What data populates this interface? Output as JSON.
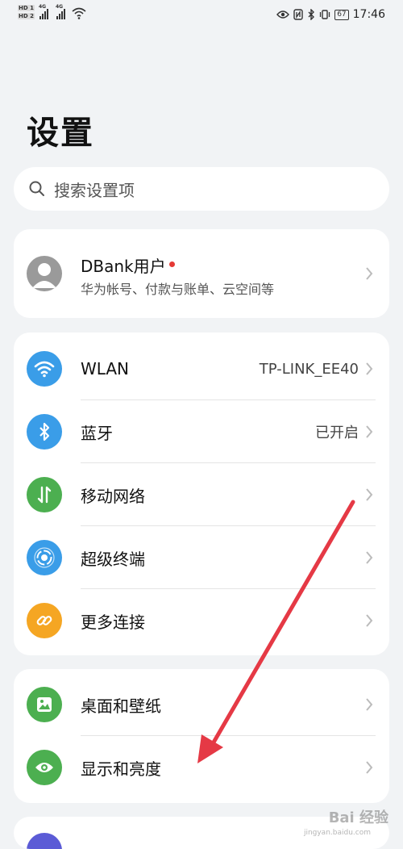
{
  "status_bar": {
    "hd1": "HD 1",
    "hd2": "HD 2",
    "net1": "4G",
    "net2": "4G",
    "battery": "67",
    "time": "17:46"
  },
  "page_title": "设置",
  "search": {
    "placeholder": "搜索设置项"
  },
  "account": {
    "name": "DBank用户",
    "subtitle": "华为帐号、付款与账单、云空间等"
  },
  "connectivity": [
    {
      "label": "WLAN",
      "value": "TP-LINK_EE40",
      "icon": "wifi-icon",
      "color": "#3a9de8"
    },
    {
      "label": "蓝牙",
      "value": "已开启",
      "icon": "bluetooth-icon",
      "color": "#3a9de8"
    },
    {
      "label": "移动网络",
      "value": "",
      "icon": "mobile-data-icon",
      "color": "#4caf50"
    },
    {
      "label": "超级终端",
      "value": "",
      "icon": "super-device-icon",
      "color": "#3a9de8"
    },
    {
      "label": "更多连接",
      "value": "",
      "icon": "link-icon",
      "color": "#f5a623"
    }
  ],
  "display_group": [
    {
      "label": "桌面和壁纸",
      "icon": "wallpaper-icon",
      "color": "#4caf50"
    },
    {
      "label": "显示和亮度",
      "icon": "eye-icon",
      "color": "#4caf50"
    }
  ],
  "watermark": {
    "text": "Bai 经验",
    "url": "jingyan.baidu.com"
  }
}
